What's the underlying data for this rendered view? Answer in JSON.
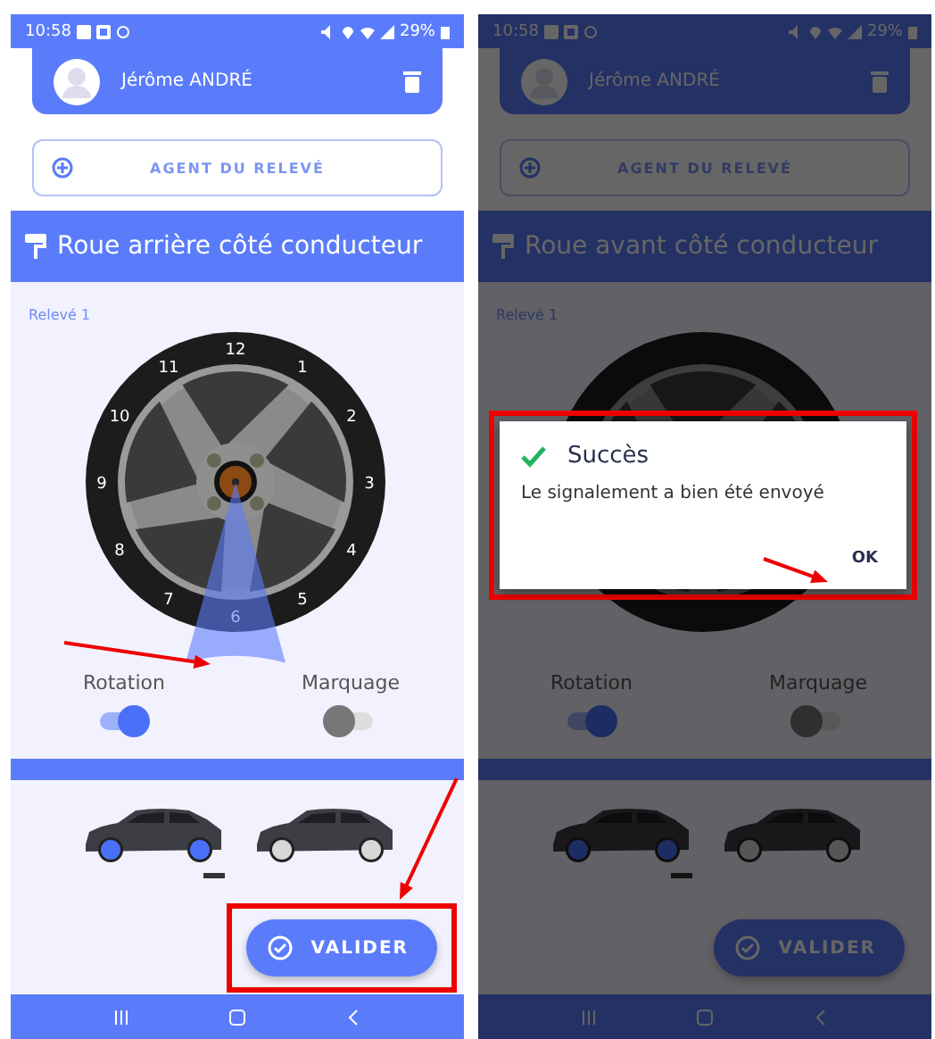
{
  "screens": [
    {
      "status_bar": {
        "time": "10:58",
        "battery": "29%"
      },
      "agent": {
        "name": "Jérôme ANDRÉ"
      },
      "agent_button": {
        "label": "AGENT DU RELEVÉ"
      },
      "section_title": "Roue arrière côté conducteur",
      "reading_label": "Relevé 1",
      "dial": [
        {
          "label": "12",
          "selected": false
        },
        {
          "label": "1",
          "selected": false
        },
        {
          "label": "2",
          "selected": false
        },
        {
          "label": "3",
          "selected": false
        },
        {
          "label": "4",
          "selected": false
        },
        {
          "label": "5",
          "selected": false
        },
        {
          "label": "6",
          "selected": true
        },
        {
          "label": "7",
          "selected": false
        },
        {
          "label": "8",
          "selected": false
        },
        {
          "label": "9",
          "selected": false
        },
        {
          "label": "10",
          "selected": false
        },
        {
          "label": "11",
          "selected": false
        }
      ],
      "toggles": [
        {
          "label": "Rotation",
          "on": true
        },
        {
          "label": "Marquage",
          "on": false
        }
      ],
      "cars": [
        {
          "selected": true
        },
        {
          "selected": false
        }
      ],
      "sector_arrow": true,
      "validate": {
        "label": "VALIDER",
        "boxed": true,
        "arrow": true
      },
      "dimmed": false
    },
    {
      "status_bar": {
        "time": "10:58",
        "battery": "29%"
      },
      "agent": {
        "name": "Jérôme ANDRÉ"
      },
      "agent_button": {
        "label": "AGENT DU RELEVÉ"
      },
      "section_title": "Roue avant côté conducteur",
      "reading_label": "Relevé 1",
      "toggles": [
        {
          "label": "Rotation",
          "on": true
        },
        {
          "label": "Marquage",
          "on": false
        }
      ],
      "cars": [
        {
          "selected": true
        },
        {
          "selected": false
        }
      ],
      "validate": {
        "label": "VALIDER",
        "boxed": false,
        "arrow": false
      },
      "dimmed": true,
      "dialog": {
        "title": "Succès",
        "message": "Le signalement a bien été envoyé",
        "button": "OK",
        "boxed": true,
        "ok_arrow": true
      }
    }
  ]
}
